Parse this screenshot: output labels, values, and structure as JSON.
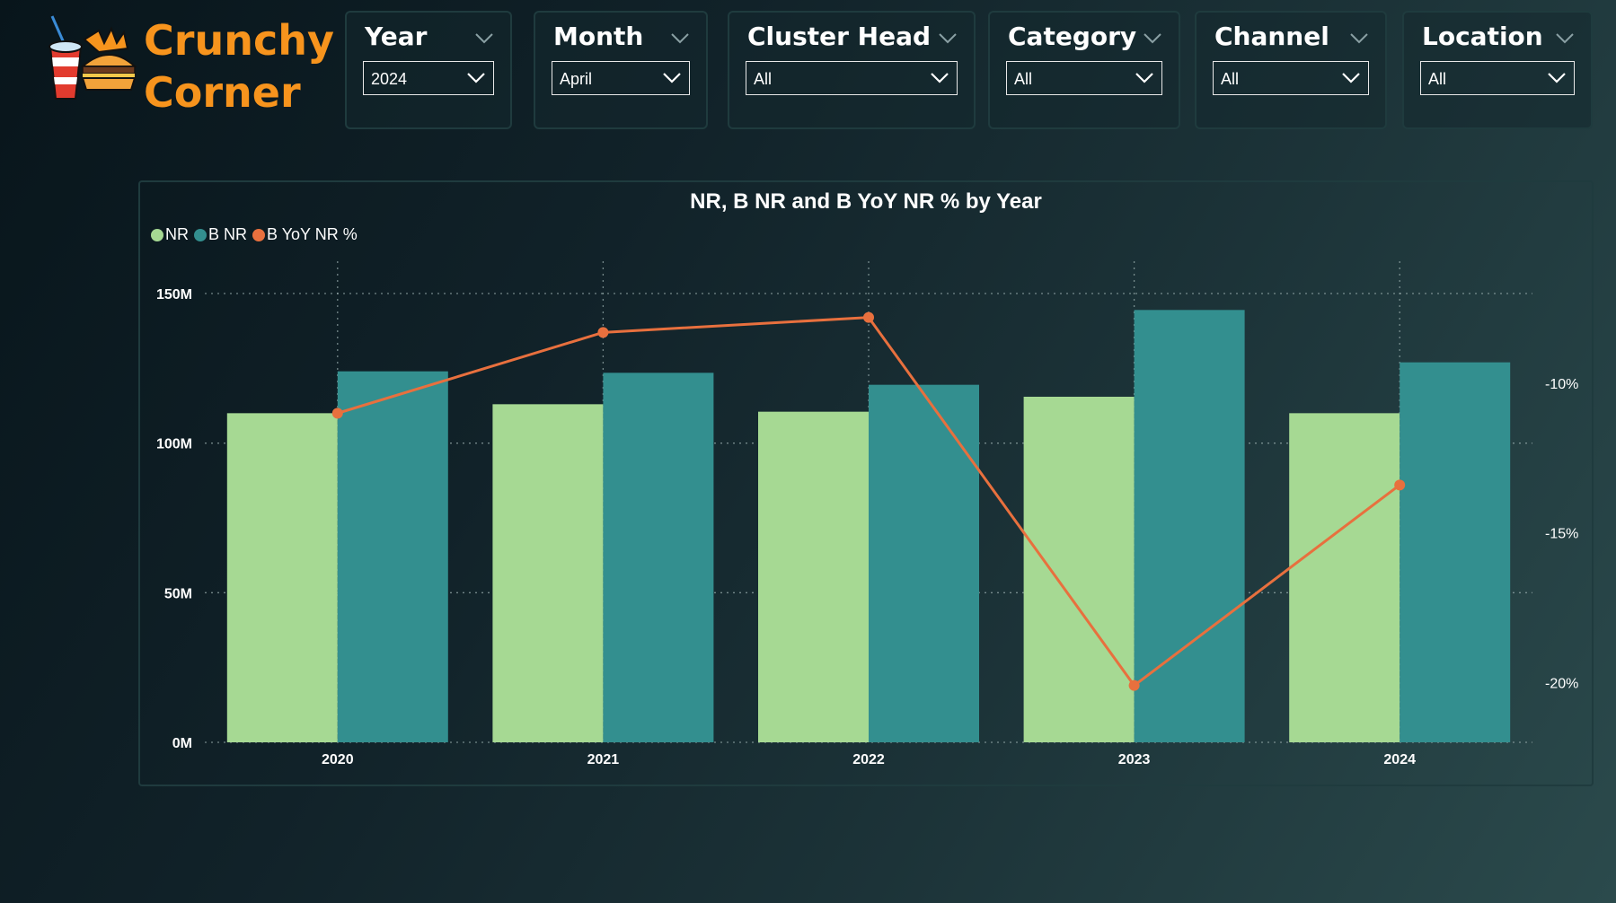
{
  "brand": {
    "line1": "Crunchy",
    "line2": "Corner"
  },
  "filters": [
    {
      "title": "Year",
      "value": "2024"
    },
    {
      "title": "Month",
      "value": "April"
    },
    {
      "title": "Cluster Head",
      "value": "All"
    },
    {
      "title": "Category",
      "value": "All"
    },
    {
      "title": "Channel",
      "value": "All"
    },
    {
      "title": "Location",
      "value": "All"
    }
  ],
  "colors": {
    "nr": "#a6d993",
    "b_nr": "#338f8f",
    "yoy": "#e8703e",
    "accent": "#f7941d"
  },
  "chart_data": {
    "type": "bar",
    "title": "NR, B NR and B YoY NR % by Year",
    "categories": [
      "2020",
      "2021",
      "2022",
      "2023",
      "2024"
    ],
    "series": [
      {
        "name": "NR",
        "type": "bar",
        "axis": "left",
        "values": [
          110,
          113,
          110.5,
          115.5,
          110
        ]
      },
      {
        "name": "B NR",
        "type": "bar",
        "axis": "left",
        "values": [
          124,
          123.5,
          119.5,
          144.5,
          127
        ]
      },
      {
        "name": "B YoY NR %",
        "type": "line",
        "axis": "right",
        "values": [
          -11.0,
          -8.3,
          -7.8,
          -20.1,
          -13.4
        ]
      }
    ],
    "y_left": {
      "ticks": [
        "0M",
        "50M",
        "100M",
        "150M"
      ],
      "range": [
        0,
        150
      ]
    },
    "y_right": {
      "ticks": [
        "-10%",
        "-15%",
        "-20%"
      ],
      "range": [
        -22,
        -7
      ]
    },
    "legend": "top-left",
    "grid": true
  }
}
